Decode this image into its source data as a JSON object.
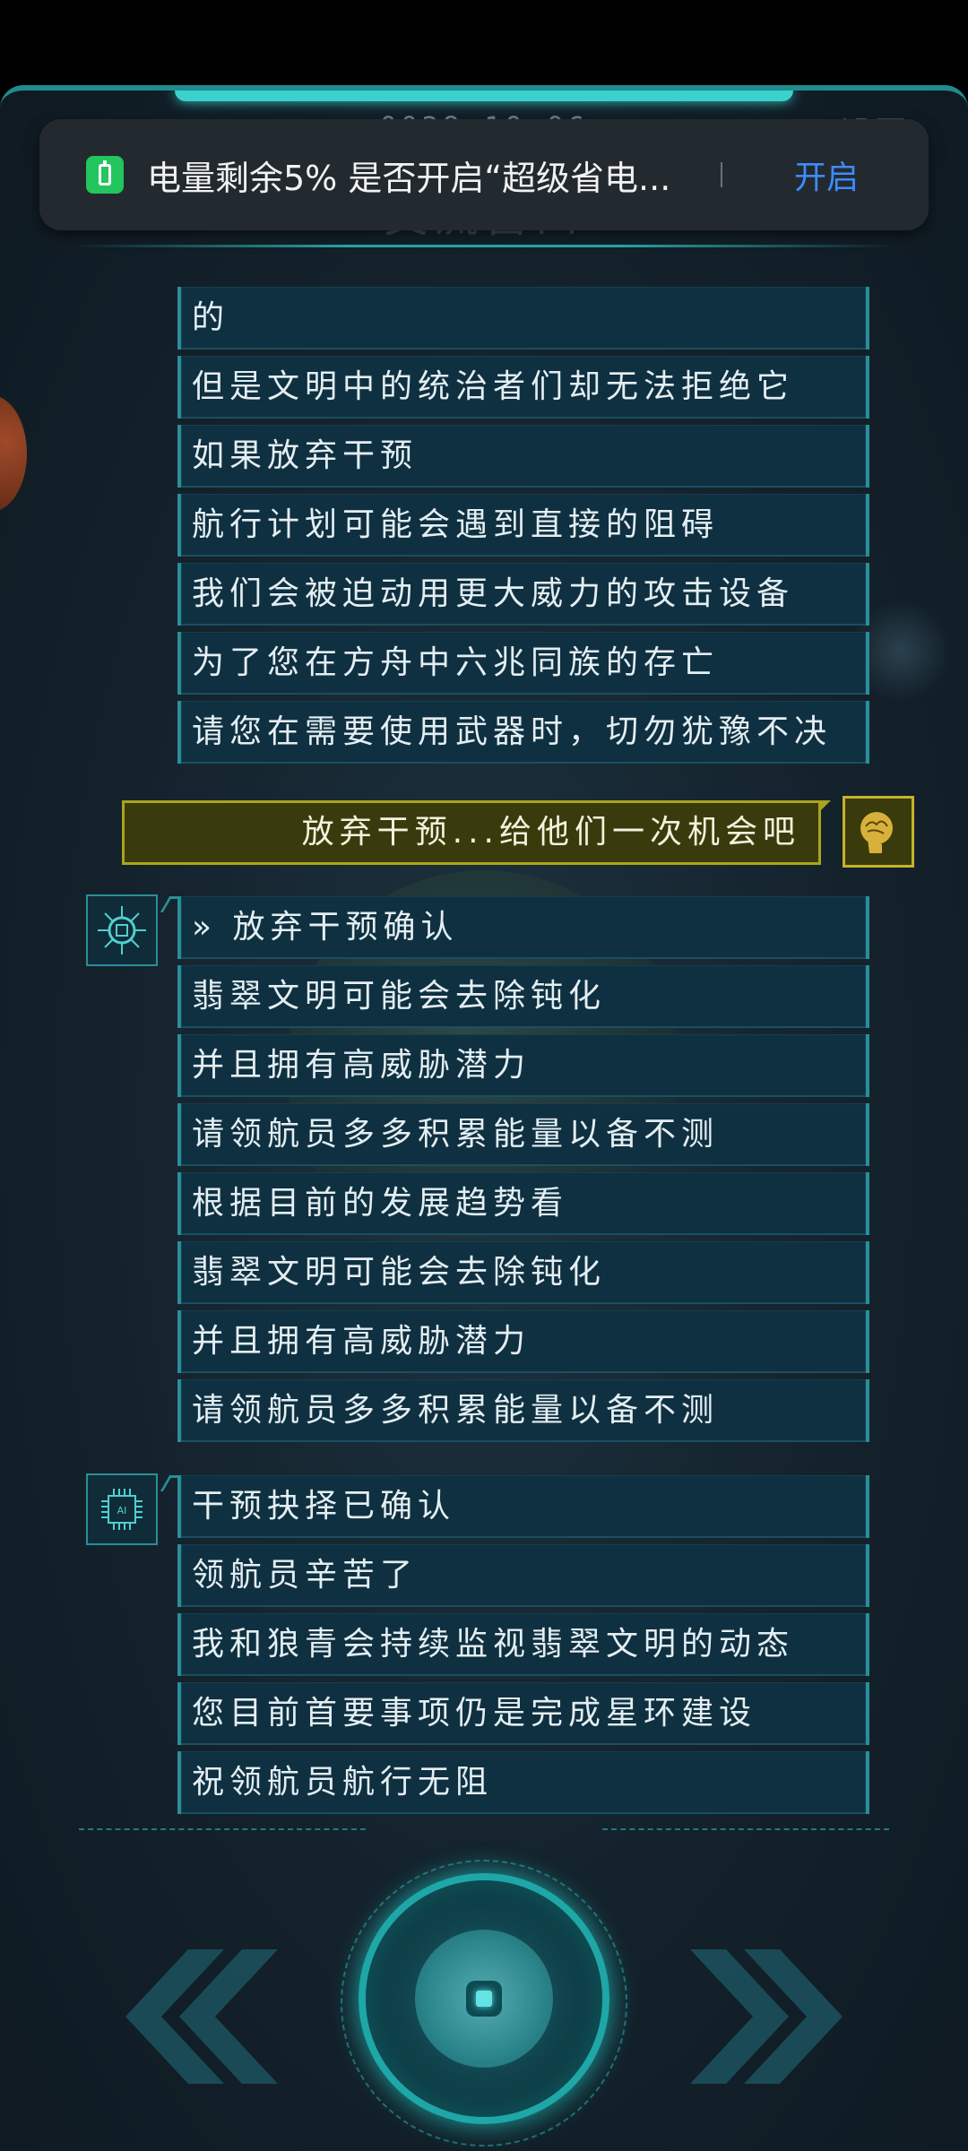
{
  "header": {
    "date": "0038.10.06",
    "settings_label": "设置",
    "title": "交流窗口"
  },
  "notification": {
    "icon": "battery-icon",
    "message": "电量剩余5%  是否开启“超级省电...",
    "action": "开启"
  },
  "dialog_group_1": [
    "的",
    "但是文明中的统治者们却无法拒绝它",
    "如果放弃干预",
    "航行计划可能会遇到直接的阻碍",
    "我们会被迫动用更大威力的攻击设备",
    "为了您在方舟中六兆同族的存亡",
    "请您在需要使用武器时，切勿犹豫不决"
  ],
  "player_choice": "放弃干预...给他们一次机会吧",
  "dialog_group_2": [
    "» 放弃干预确认",
    "翡翠文明可能会去除钝化",
    "并且拥有高威胁潜力",
    "请领航员多多积累能量以备不测",
    "根据目前的发展趋势看",
    "翡翠文明可能会去除钝化",
    "并且拥有高威胁潜力",
    "请领航员多多积累能量以备不测"
  ],
  "dialog_group_3": [
    "干预抉择已确认",
    "领航员辛苦了",
    "我和狼青会持续监视翡翠文明的动态",
    "您目前首要事项仍是完成星环建设",
    "祝领航员航行无阻"
  ],
  "colors": {
    "accent": "#1ea7a6",
    "bubble": "#0f3040",
    "choice_bg": "#3a3b0c",
    "choice_border": "#a9a51c",
    "notify_action": "#3d8bff"
  }
}
